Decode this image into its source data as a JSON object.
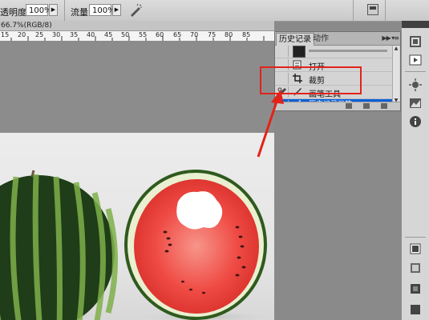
{
  "options_bar": {
    "opacity_label": "透明度:",
    "opacity_value": "100%",
    "flow_label": "流量:",
    "flow_value": "100%"
  },
  "document": {
    "tab_title": "66.7%(RGB/8)",
    "ruler_ticks": [
      "15",
      "20",
      "25",
      "30",
      "35",
      "40",
      "45",
      "50",
      "55",
      "60",
      "65",
      "70",
      "75",
      "80",
      "85"
    ]
  },
  "history_panel": {
    "tabs": [
      "历史记录",
      "动作"
    ],
    "items": [
      {
        "label": "打开",
        "icon": "open-icon"
      },
      {
        "label": "裁剪",
        "icon": "crop-icon"
      },
      {
        "label": "画笔工具",
        "icon": "brush-icon"
      },
      {
        "label": "历史记录画笔",
        "icon": "history-brush-icon",
        "selected": true
      }
    ]
  },
  "colors": {
    "selection": "#0a5fd8",
    "callout": "#e2231a",
    "flesh": "#ef4b44",
    "rind_dark": "#1f3d18",
    "rind_light": "#7fb04a"
  }
}
